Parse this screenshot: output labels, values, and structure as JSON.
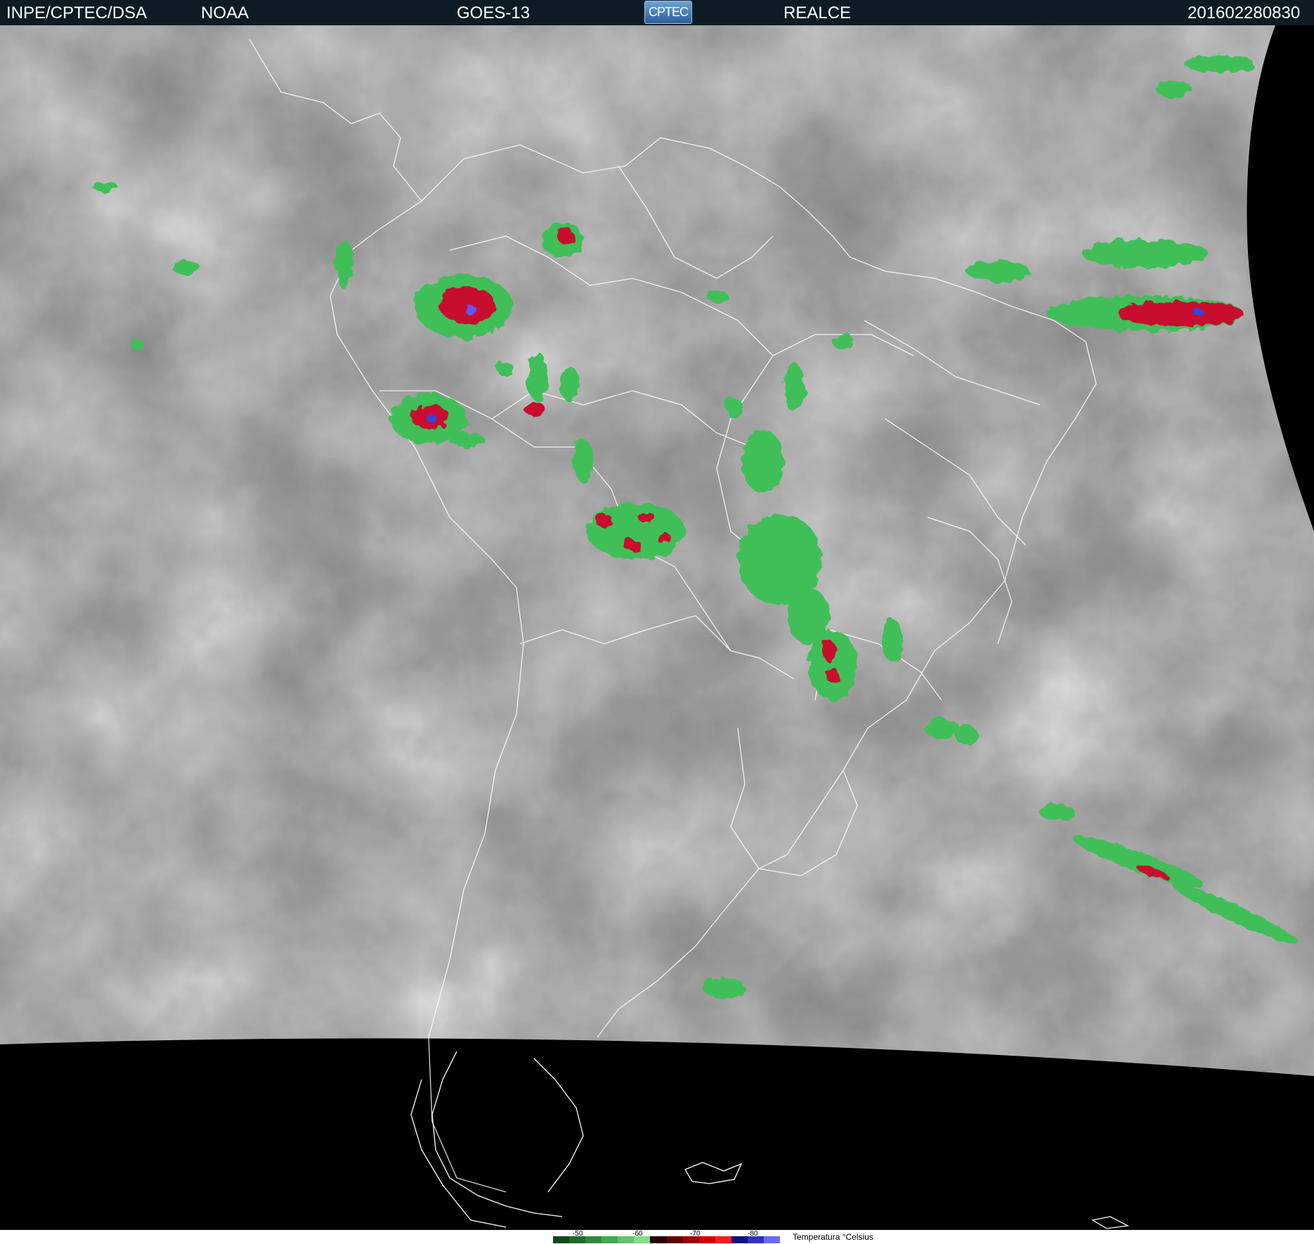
{
  "header": {
    "agency": "INPE/CPTEC/DSA",
    "partner": "NOAA",
    "satellite": "GOES-13",
    "logo_text": "CPTEC",
    "product": "REALCE",
    "timestamp": "201602280830"
  },
  "legend": {
    "title": "Temperatura  °Celsius",
    "ticks": [
      "-50",
      "-60",
      "-70",
      "-80"
    ],
    "colors": [
      "#0f4a18",
      "#1f6a2a",
      "#2f8a3c",
      "#3faa50",
      "#5fc46a",
      "#7fe08a",
      "#2a0000",
      "#600000",
      "#9a0000",
      "#d40000",
      "#ff1a1a",
      "#101080",
      "#3030c0",
      "#6a6aff"
    ]
  },
  "colors": {
    "header_bg": "#0d1c24",
    "space": "#000000",
    "boundary": "#ffffff",
    "cold_green": "#4cd463",
    "cold_red": "#d01020",
    "cold_blue": "#3344dd"
  }
}
